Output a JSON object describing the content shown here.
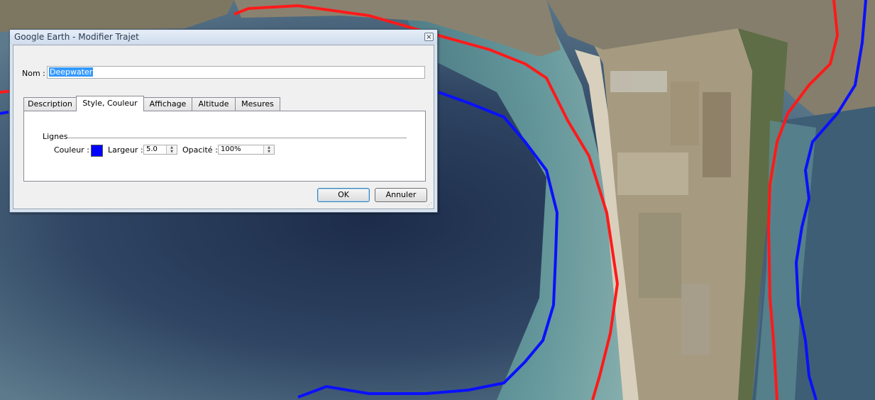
{
  "dialog": {
    "title": "Google Earth - Modifier Trajet",
    "close_glyph": "×",
    "name_label": "Nom :",
    "name_value": "Deepwater",
    "tabs": [
      {
        "label": "Description",
        "active": false
      },
      {
        "label": "Style, Couleur",
        "active": true
      },
      {
        "label": "Affichage",
        "active": false
      },
      {
        "label": "Altitude",
        "active": false
      },
      {
        "label": "Mesures",
        "active": false
      }
    ],
    "style": {
      "group_label": "Lignes",
      "color_label": "Couleur :",
      "line_color": "#0000ff",
      "width_label": "Largeur :",
      "width_value": "5.0",
      "opacity_label": "Opacité :",
      "opacity_value": "100%"
    },
    "ok_label": "OK",
    "cancel_label": "Annuler"
  },
  "map": {
    "red_line_color": "#ff1a1a",
    "blue_line_color": "#0a10ff"
  }
}
